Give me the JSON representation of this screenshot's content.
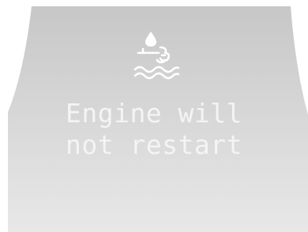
{
  "display": {
    "warning_icon": "coolant-leak-warning-icon",
    "message_line1": "Engine will",
    "message_line2": "not restart",
    "colors": {
      "panel_top": "#c8c8c8",
      "panel_bottom": "#e6e6e6",
      "text": "#f4f4f4",
      "icon": "#ffffff"
    }
  }
}
